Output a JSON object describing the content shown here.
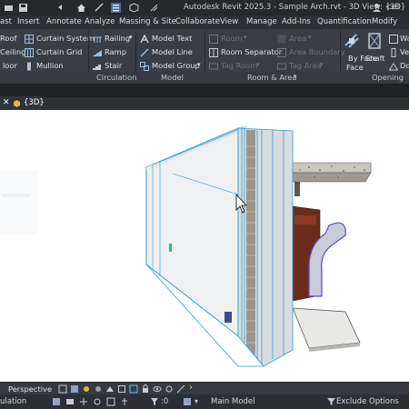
{
  "window": {
    "title": "Autodesk Revit 2025.3 - Sample Arch.rvt - 3D View: {3D}",
    "user_partial": "ces"
  },
  "menu": [
    "ast",
    "Insert",
    "Annotate",
    "Analyze",
    "Massing & Site",
    "Collaborate",
    "View",
    "Manage",
    "Add-Ins",
    "Quantification",
    "Modify"
  ],
  "ribbon": {
    "build_left": [
      "Roof",
      "Ceiling",
      "loor"
    ],
    "build_curtain": [
      "Curtain  System",
      "Curtain  Grid",
      "Mullion"
    ],
    "circulation": {
      "items": [
        "Railing",
        "Ramp",
        "Stair"
      ],
      "label": "Circulation"
    },
    "model": {
      "items": [
        "Model  Text",
        "Model  Line",
        "Model  Group"
      ],
      "label": "Model"
    },
    "room_area": {
      "col1": [
        "Room",
        "Room  Separator",
        "Tag  Room"
      ],
      "col2": [
        "Area",
        "Area  Boundary",
        "Tag  Area"
      ],
      "label": "Room & Area"
    },
    "opening": {
      "by_face": "By Face",
      "by_face_line2": "Face",
      "shaft": "Shaft",
      "right_items": [
        "Wa",
        "Ver",
        "Dor"
      ],
      "label": "Opening"
    }
  },
  "view_tab": {
    "label": "{3D}"
  },
  "viewbar": {
    "mode": "Perspective"
  },
  "statusbar": {
    "left": "ulation",
    "zero": ":0",
    "workset": "Main Model",
    "exclude": "Exclude Options"
  },
  "colors": {
    "accent": "#2e9ed4",
    "ribbon_bg": "#383d46",
    "canvas": "#ffffff"
  }
}
